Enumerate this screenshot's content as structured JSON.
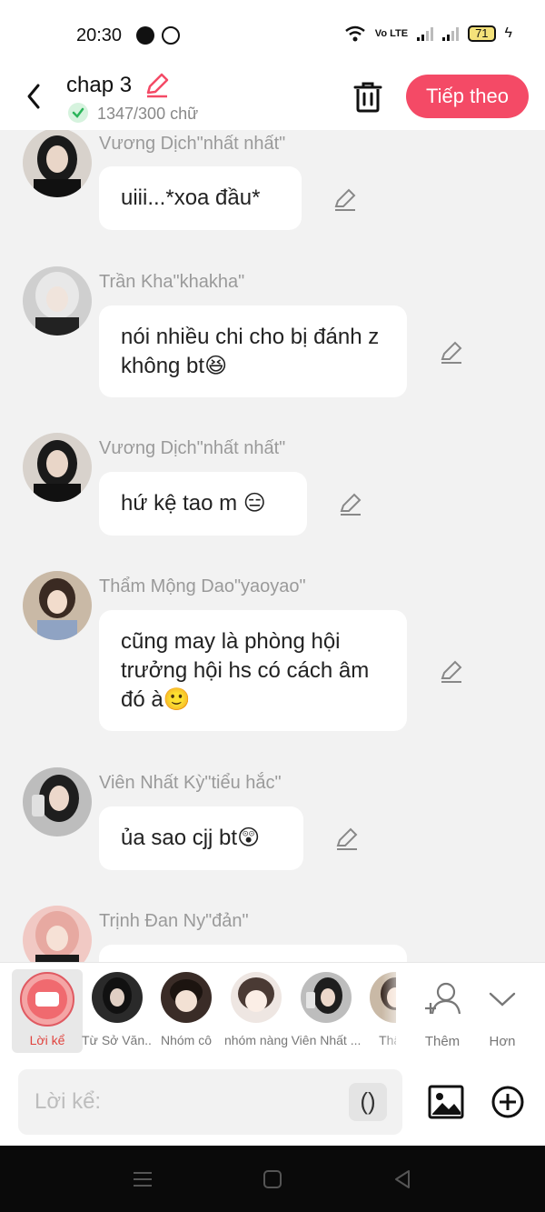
{
  "status_bar": {
    "time": "20:30",
    "battery": "71",
    "app_icons": [
      "baomoi-icon",
      "smiley-icon"
    ],
    "network_label": "Vo LTE"
  },
  "header": {
    "title": "chap 3",
    "word_count": "1347/300 chữ",
    "next_label": "Tiếp theo",
    "accent_color": "#f44a66"
  },
  "messages": [
    {
      "sender": "Vương Dịch\"nhất nhất\"",
      "text": "uiii...*xoa đầu*",
      "avatar": "avatar-vuong-dich"
    },
    {
      "sender": "Trần Kha\"khakha\"",
      "text": "nói nhiều chi cho bị đánh z không bt😆",
      "avatar": "avatar-tran-kha"
    },
    {
      "sender": "Vương Dịch\"nhất nhất\"",
      "text": "hứ kệ tao m 😑",
      "avatar": "avatar-vuong-dich"
    },
    {
      "sender": "Thẩm Mộng Dao\"yaoyao\"",
      "text": "cũng may là phòng hội trưởng hội hs có cách âm đó à🙂",
      "avatar": "avatar-tham-mong-dao"
    },
    {
      "sender": "Viên Nhất Kỳ\"tiểu hắc\"",
      "text": "ủa sao cjj bt😲",
      "avatar": "avatar-vien-nhat-ky"
    },
    {
      "sender": "Trịnh Đan Ny\"đản\"",
      "text": "",
      "avatar": "avatar-trinh-dan-ny"
    }
  ],
  "characters_bar": {
    "narrator_label": "Lời kể",
    "characters": [
      "Từ Sở Văn...",
      "Nhóm cô",
      "nhóm nàng",
      "Viên Nhất ...",
      "Thẩm"
    ],
    "add_label": "Thêm",
    "more_label": "Hơn"
  },
  "input": {
    "placeholder": "Lời kể:",
    "paren_label": "()"
  }
}
